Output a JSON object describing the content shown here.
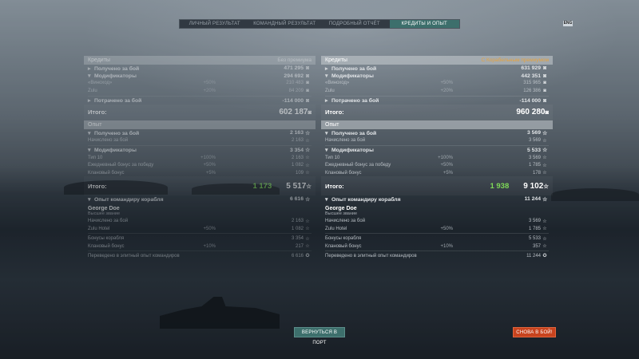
{
  "tabs": [
    "ЛИЧНЫЙ РЕЗУЛЬТАТ",
    "КОМАНДНЫЙ РЕЗУЛЬТАТ",
    "ПОДРОБНЫЙ ОТЧЁТ",
    "КРЕДИТЫ И ОПЫТ"
  ],
  "active_tab": 3,
  "flag_label": "ENG",
  "left": {
    "credits_title": "Кредиты",
    "credits_sub": "Без премиума",
    "earned_label": "Получено за бой",
    "earned_value": "471 295",
    "mods_label": "Модификаторы",
    "mods_value": "294 692",
    "mod1_label": "«Виноход»",
    "mod1_pct": "+50%",
    "mod1_value": "210 483",
    "mod2_label": "Zulu",
    "mod2_pct": "+20%",
    "mod2_value": "84 209",
    "spent_label": "Потрачено за бой",
    "spent_value": "-114 000",
    "total_label": "Итого:",
    "total_value": "602 187",
    "xp_title": "Опыт",
    "xp_earned_label": "Получено за бой",
    "xp_earned_value": "2 163",
    "xp_base_label": "Начислено за бой",
    "xp_base_value": "2 163",
    "xp_mods_label": "Модификаторы",
    "xp_mods_value": "3 354",
    "xm1_label": "Тип 10",
    "xm1_pct": "+100%",
    "xm1_value": "2 163",
    "xm2_label": "Ежедневный бонус за победу",
    "xm2_pct": "+50%",
    "xm2_value": "1 082",
    "xm3_label": "Клановый бонус",
    "xm3_pct": "+5%",
    "xm3_value": "109",
    "xp_total_label": "Итого:",
    "xp_total_green": "1 173",
    "xp_total_value": "5 517",
    "cap_label": "Опыт командиру корабля",
    "cap_value": "6 616",
    "cap_name": "George Doe",
    "cap_rank": "Высшее звание",
    "c1_label": "Начислено за бой",
    "c1_value": "2 163",
    "c2_label": "Zulu Hotel",
    "c2_pct": "+50%",
    "c2_value": "1 082",
    "c3_label": "Бонусы корабля",
    "c3_value": "3 354",
    "c4_label": "Клановый бонус",
    "c4_pct": "+10%",
    "c4_value": "217",
    "c5_label": "Переведено в элитный опыт командиров",
    "c5_value": "6 616"
  },
  "right": {
    "credits_title": "Кредиты",
    "credits_sub": "С Корабельным премиумом",
    "earned_label": "Получено за бой",
    "earned_value": "631 929",
    "mods_label": "Модификаторы",
    "mods_value": "442 351",
    "mod1_label": "«Виноход»",
    "mod1_pct": "+50%",
    "mod1_value": "315 965",
    "mod2_label": "Zulu",
    "mod2_pct": "+20%",
    "mod2_value": "126 386",
    "spent_label": "Потрачено за бой",
    "spent_value": "-114 000",
    "total_label": "Итого:",
    "total_value": "960 280",
    "xp_title": "Опыт",
    "xp_earned_label": "Получено за бой",
    "xp_earned_value": "3 569",
    "xp_base_label": "Начислено за бой",
    "xp_base_value": "3 569",
    "xp_mods_label": "Модификаторы",
    "xp_mods_value": "5 533",
    "xm1_label": "Тип 10",
    "xm1_pct": "+100%",
    "xm1_value": "3 569",
    "xm2_label": "Ежедневный бонус за победу",
    "xm2_pct": "+50%",
    "xm2_value": "1 785",
    "xm3_label": "Клановый бонус",
    "xm3_pct": "+5%",
    "xm3_value": "178",
    "xp_total_label": "Итого:",
    "xp_total_green": "1 938",
    "xp_total_value": "9 102",
    "cap_label": "Опыт командиру корабля",
    "cap_value": "11 244",
    "cap_name": "George Doe",
    "cap_rank": "Высшее звание",
    "c1_label": "Начислено за бой",
    "c1_value": "3 569",
    "c2_label": "Zulu Hotel",
    "c2_pct": "+50%",
    "c2_value": "1 785",
    "c3_label": "Бонусы корабля",
    "c3_value": "5 533",
    "c4_label": "Клановый бонус",
    "c4_pct": "+10%",
    "c4_value": "357",
    "c5_label": "Переведено в элитный опыт командиров",
    "c5_value": "11 244"
  },
  "buttons": {
    "port": "ВЕРНУТЬСЯ В ПОРТ",
    "battle": "СНОВА В БОЙ!"
  },
  "icons": {
    "credits": "credits-icon",
    "xp": "xp-star-icon",
    "free_xp": "free-xp-icon"
  },
  "colors": {
    "accent_teal": "#3d6f6c",
    "accent_orange": "#c8431e",
    "premium": "#e8a23a",
    "bonus_green": "#7ed957"
  }
}
